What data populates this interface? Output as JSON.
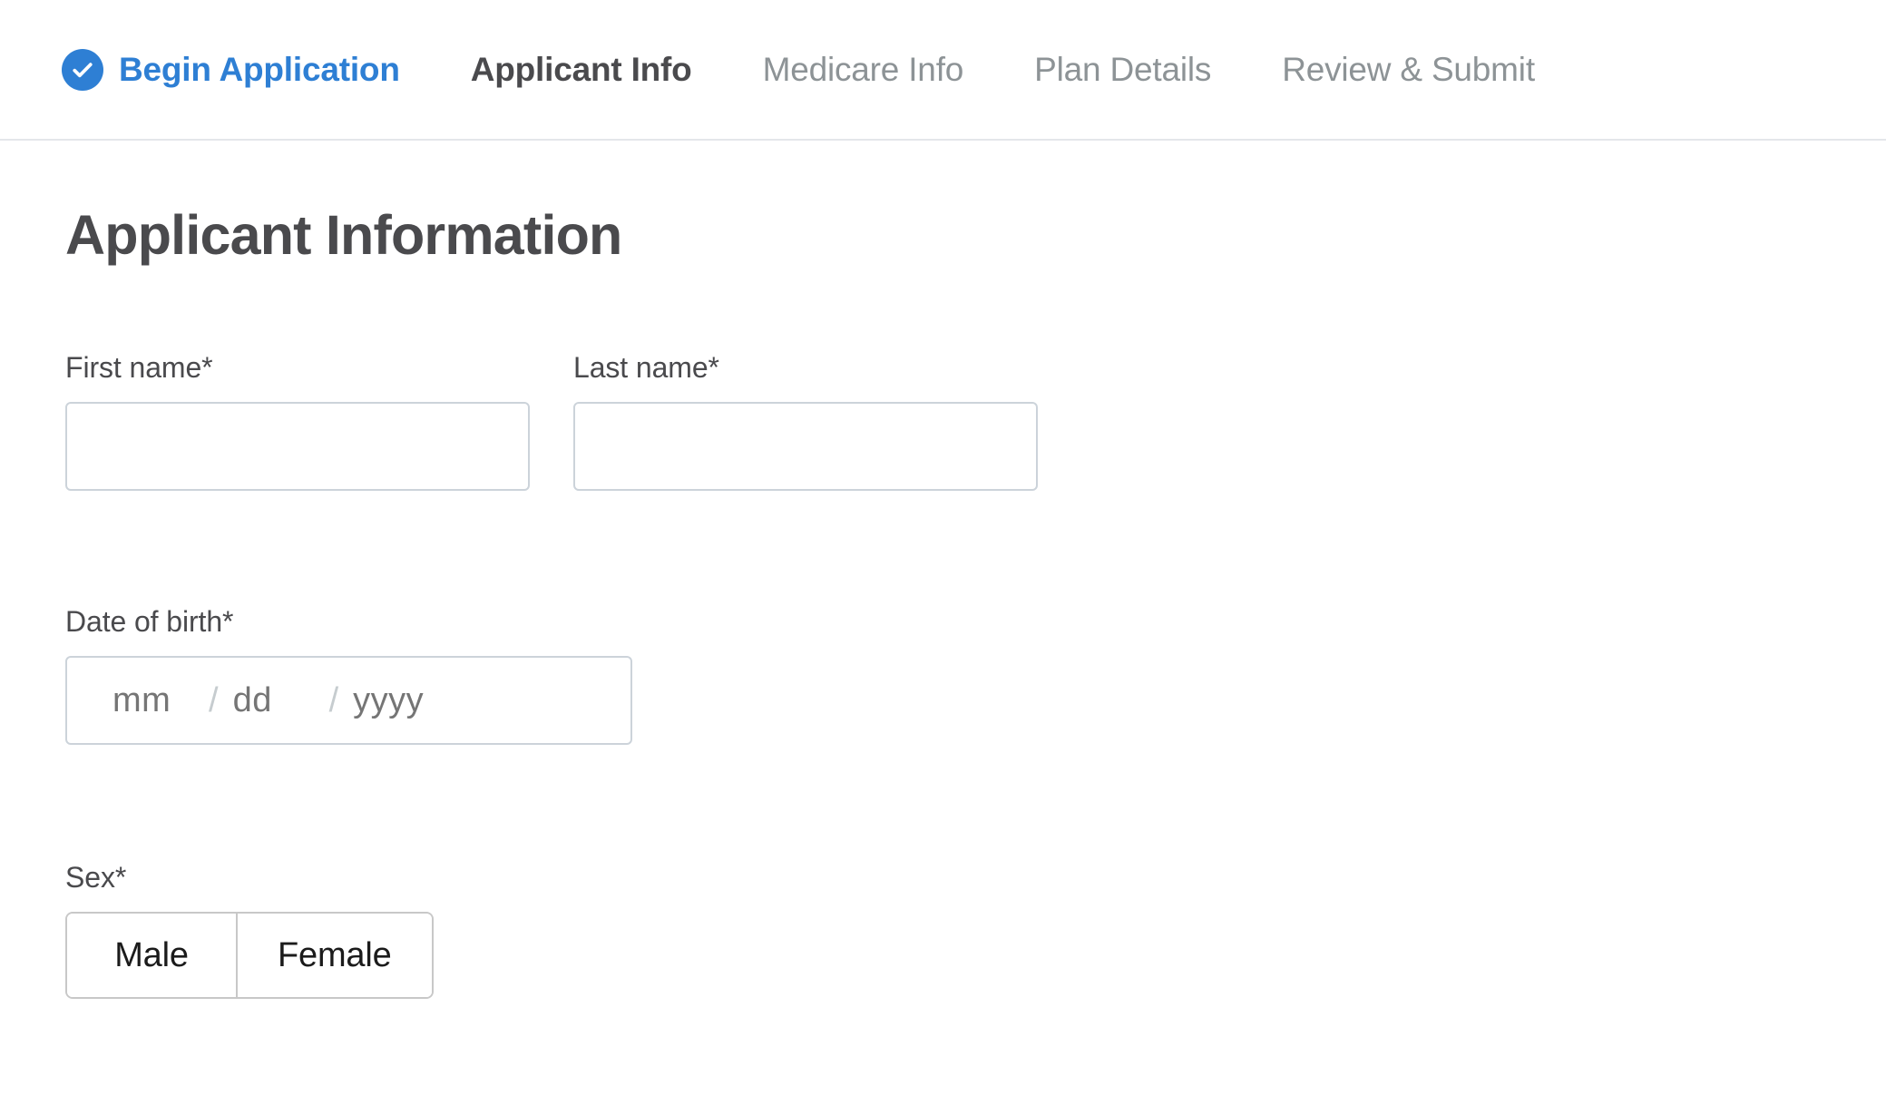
{
  "stepper": {
    "steps": [
      {
        "label": "Begin Application",
        "state": "done",
        "icon": "check-circle-icon"
      },
      {
        "label": "Applicant Info",
        "state": "active",
        "icon": ""
      },
      {
        "label": "Medicare Info",
        "state": "todo",
        "icon": ""
      },
      {
        "label": "Plan Details",
        "state": "todo",
        "icon": ""
      },
      {
        "label": "Review & Submit",
        "state": "todo",
        "icon": ""
      }
    ]
  },
  "main": {
    "title": "Applicant Information",
    "first_name": {
      "label": "First name*",
      "value": "",
      "placeholder": ""
    },
    "last_name": {
      "label": "Last name*",
      "value": "",
      "placeholder": ""
    },
    "date_of_birth": {
      "label": "Date of birth*",
      "month_placeholder": "mm",
      "day_placeholder": "dd",
      "year_placeholder": "yyyy",
      "separator": "/",
      "month_value": "",
      "day_value": "",
      "year_value": ""
    },
    "sex": {
      "label": "Sex*",
      "options": [
        "Male",
        "Female"
      ],
      "selected": ""
    }
  },
  "colors": {
    "accent_blue": "#2e7fd4",
    "active_text": "#4a4a4d",
    "inactive_text": "#8d9396",
    "input_border": "#ccd3da",
    "toggle_border": "#c8c8c8",
    "placeholder": "#b9c0c5",
    "divider": "#e4e6ea"
  }
}
